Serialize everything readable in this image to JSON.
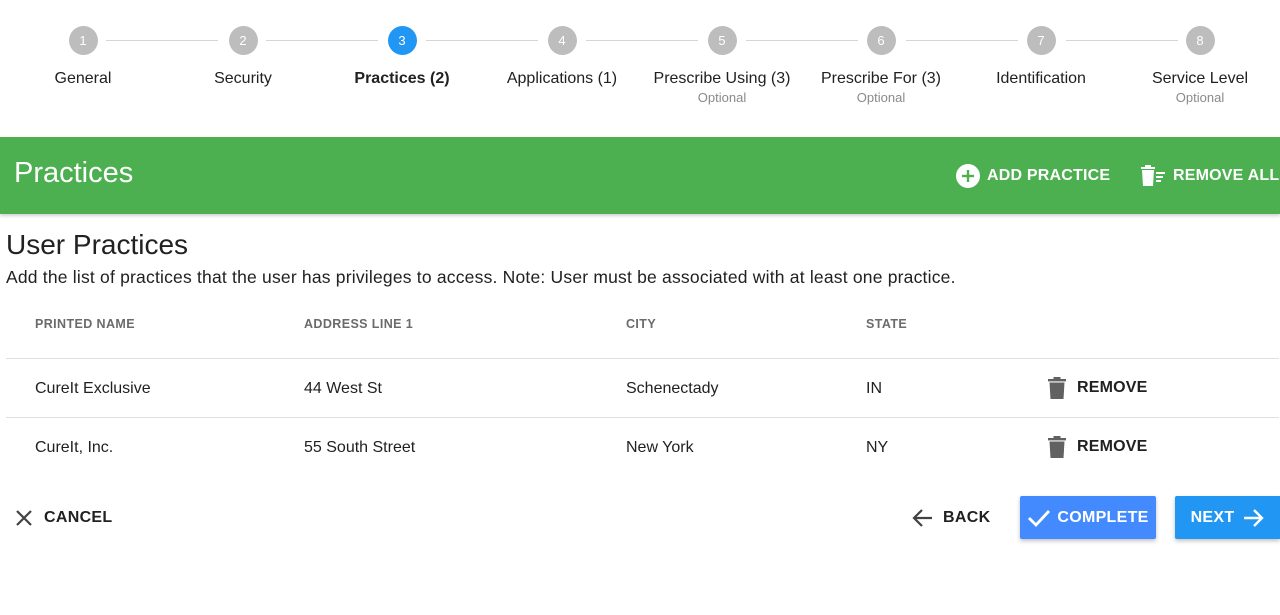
{
  "stepper": {
    "steps": [
      {
        "number": "1",
        "label": "General",
        "optional": ""
      },
      {
        "number": "2",
        "label": "Security",
        "optional": ""
      },
      {
        "number": "3",
        "label": "Practices (2)",
        "optional": ""
      },
      {
        "number": "4",
        "label": "Applications (1)",
        "optional": ""
      },
      {
        "number": "5",
        "label": "Prescribe Using (3)",
        "optional": "Optional"
      },
      {
        "number": "6",
        "label": "Prescribe For (3)",
        "optional": "Optional"
      },
      {
        "number": "7",
        "label": "Identification",
        "optional": ""
      },
      {
        "number": "8",
        "label": "Service Level",
        "optional": "Optional"
      }
    ],
    "active_step": "3"
  },
  "section": {
    "title": "Practices",
    "add_label": "ADD PRACTICE",
    "remove_all_label": "REMOVE ALL"
  },
  "content": {
    "title": "User Practices",
    "description": "Add the list of practices that the user has privileges to access. Note: User must be associated with at least one practice."
  },
  "table": {
    "headers": [
      "PRINTED NAME",
      "ADDRESS LINE 1",
      "CITY",
      "STATE"
    ],
    "rows": [
      {
        "name": "CureIt Exclusive",
        "address": "44 West St",
        "city": "Schenectady",
        "state": "IN",
        "action": "REMOVE"
      },
      {
        "name": "CureIt, Inc.",
        "address": "55 South Street",
        "city": "New York",
        "state": "NY",
        "action": "REMOVE"
      }
    ]
  },
  "footer": {
    "cancel_label": "CANCEL",
    "back_label": "BACK",
    "complete_label": "COMPLETE",
    "next_label": "NEXT"
  },
  "icons": {
    "add": "add-circle-icon",
    "remove_all": "clear-all-icon",
    "delete": "trash-icon",
    "cancel": "close-icon",
    "back": "arrow-left-icon",
    "complete": "check-icon",
    "next": "arrow-right-icon"
  },
  "colors": {
    "header_bar": "#4caf50",
    "active_step": "#2196f3",
    "inactive_step": "#bdbdbd",
    "complete_button": "#448aff",
    "next_button": "#2196f3"
  }
}
